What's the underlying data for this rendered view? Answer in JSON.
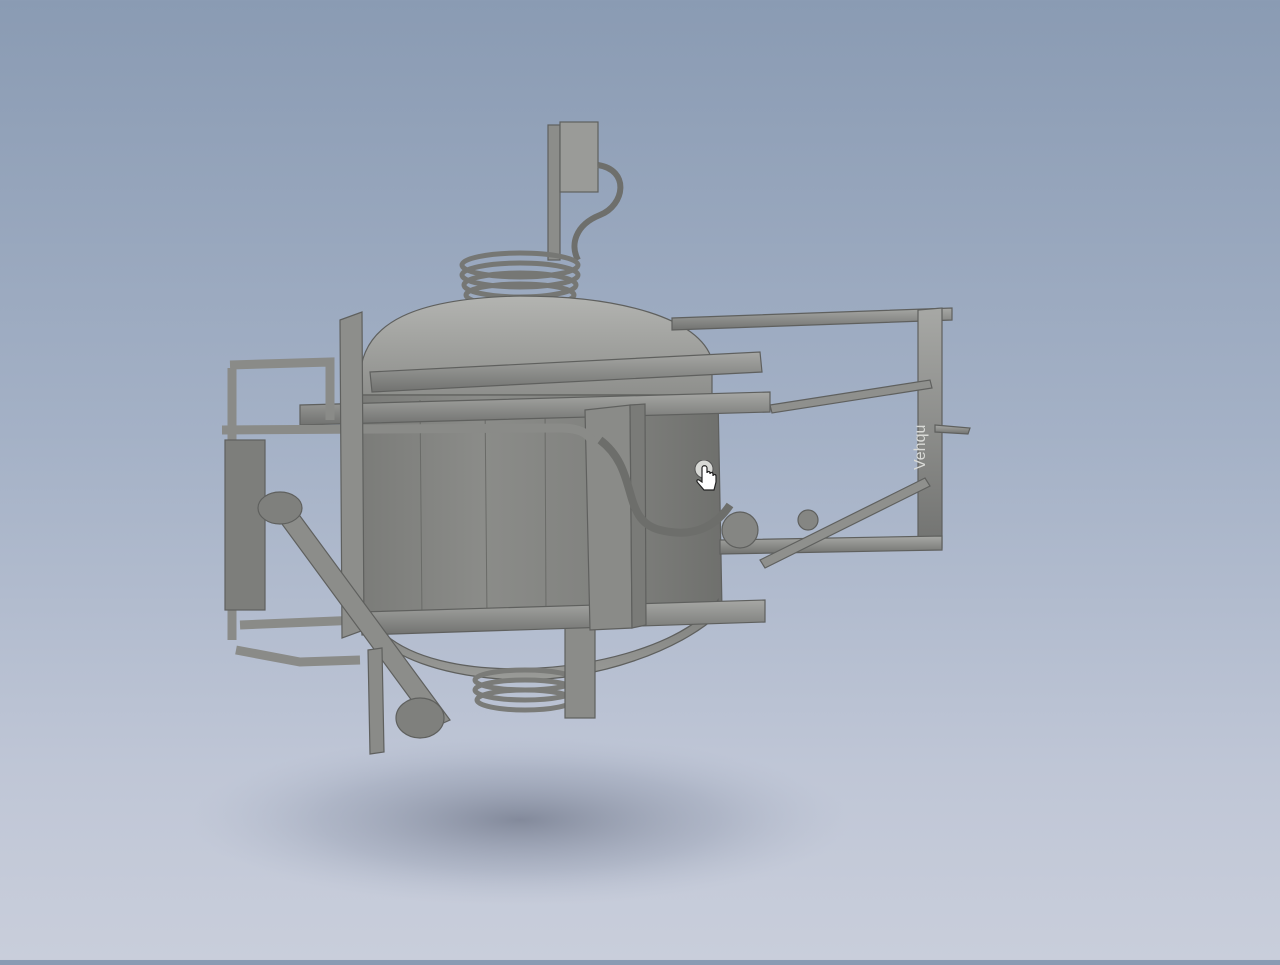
{
  "viewport": {
    "model_name": "sprayer-tank-assembly",
    "background_colors": [
      "#8a9bb3",
      "#c9cedb"
    ],
    "model_color": "#8e8f8c"
  },
  "decal": {
    "text": "Vehqu"
  },
  "cursor": {
    "type": "hand-pointer"
  }
}
